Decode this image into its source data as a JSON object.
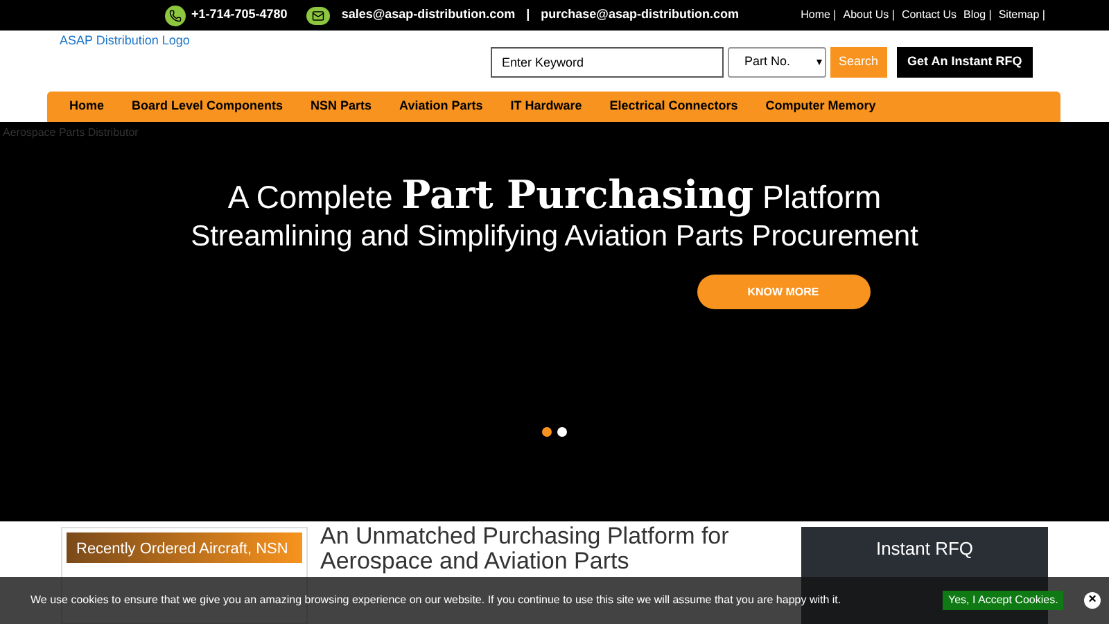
{
  "top_bar": {
    "phone": "+1-714-705-4780",
    "email_sales": "sales@asap-distribution.com",
    "separator": "|",
    "email_purchase": "purchase@asap-distribution.com",
    "links": [
      {
        "label": "Home |"
      },
      {
        "label": "About Us |"
      },
      {
        "label": "Contact Us"
      },
      {
        "label": "Blog |"
      },
      {
        "label": "Sitemap |"
      }
    ]
  },
  "header": {
    "logo_alt": "ASAP Distribution Logo",
    "search": {
      "placeholder": "Enter Keyword",
      "select_value": "Part No.",
      "button": "Search"
    },
    "rfq_button": "Get An Instant RFQ"
  },
  "nav": [
    {
      "label": "Home"
    },
    {
      "label": "Board Level Components"
    },
    {
      "label": "NSN Parts"
    },
    {
      "label": "Aviation Parts"
    },
    {
      "label": "IT Hardware"
    },
    {
      "label": "Electrical Connectors"
    },
    {
      "label": "Computer Memory"
    }
  ],
  "hero": {
    "image_alt": "Aerospace Parts Distributor",
    "headline_before": "A Complete",
    "headline_emphasis": "Part Purchasing",
    "headline_after": "Platform",
    "subheadline": "Streamlining and Simplifying Aviation Parts Procurement",
    "button": "KNOW MORE",
    "dots": [
      {
        "selected": true
      },
      {
        "selected": false
      }
    ]
  },
  "section": {
    "recent_tab": "Recently Ordered Aircraft, NSN",
    "heading": "An Unmatched Purchasing Platform for Aerospace and Aviation Parts",
    "rfq_title": "Instant RFQ"
  },
  "cookie_bar": {
    "text": "We use cookies to ensure that we give you an amazing browsing experience on our website. If you continue to use this site we will assume that you are happy with it.",
    "accept": "Yes, I Accept Cookies.",
    "close": "×"
  }
}
